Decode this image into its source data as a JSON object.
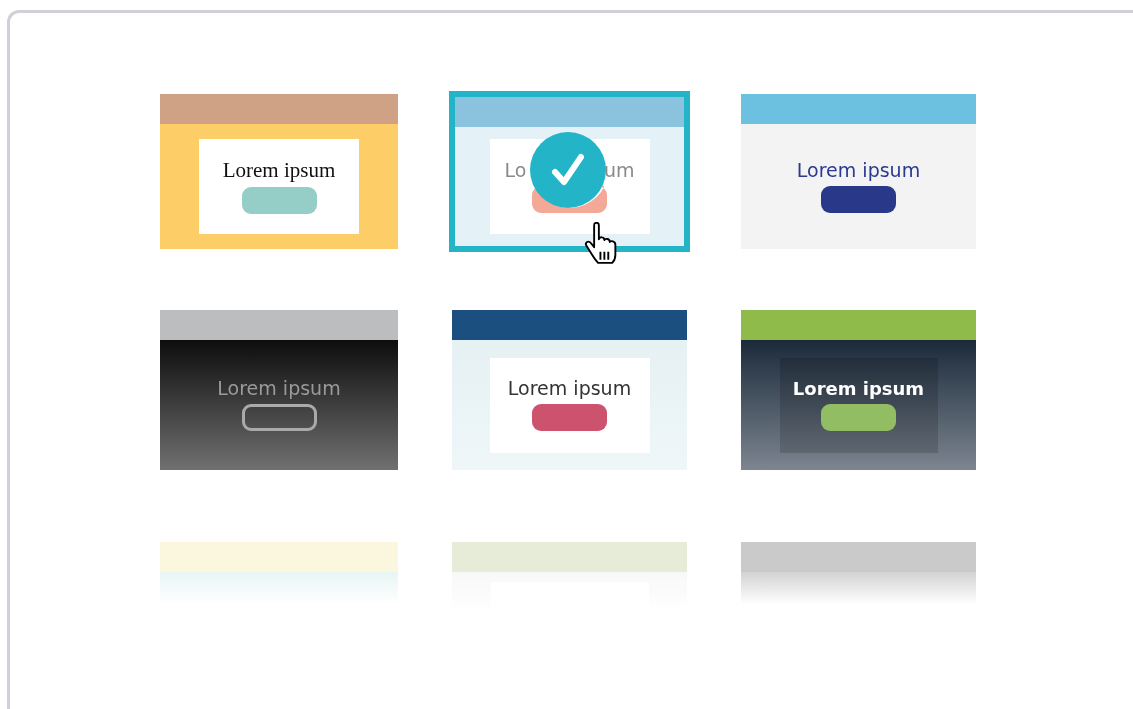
{
  "tiles": [
    {
      "kind": "sand",
      "selected": false,
      "color": "#fdcd67",
      "label": "Lorem ipsum"
    },
    {
      "kind": "sky",
      "selected": true,
      "color": "#e4f1f7",
      "label_start": "Lo",
      "label_end": "um"
    },
    {
      "kind": "azure",
      "selected": false,
      "color": "#f3f3f3",
      "label": "Lorem ipsum"
    },
    {
      "kind": "noir",
      "selected": false,
      "color": "#0c0d0c",
      "label": "Lorem ipsum"
    },
    {
      "kind": "navy",
      "selected": false,
      "color": "#e6f1f4",
      "label": "Lorem ipsum"
    },
    {
      "kind": "forest",
      "selected": false,
      "color": "#1b2a3a",
      "label": "Lorem ipsum"
    },
    {
      "kind": "cream",
      "selected": false,
      "color": "#e3f3f3"
    },
    {
      "kind": "sage",
      "selected": false,
      "color": "#f7f7f7"
    },
    {
      "kind": "silver",
      "selected": false,
      "color": "#c8c8ca"
    }
  ]
}
